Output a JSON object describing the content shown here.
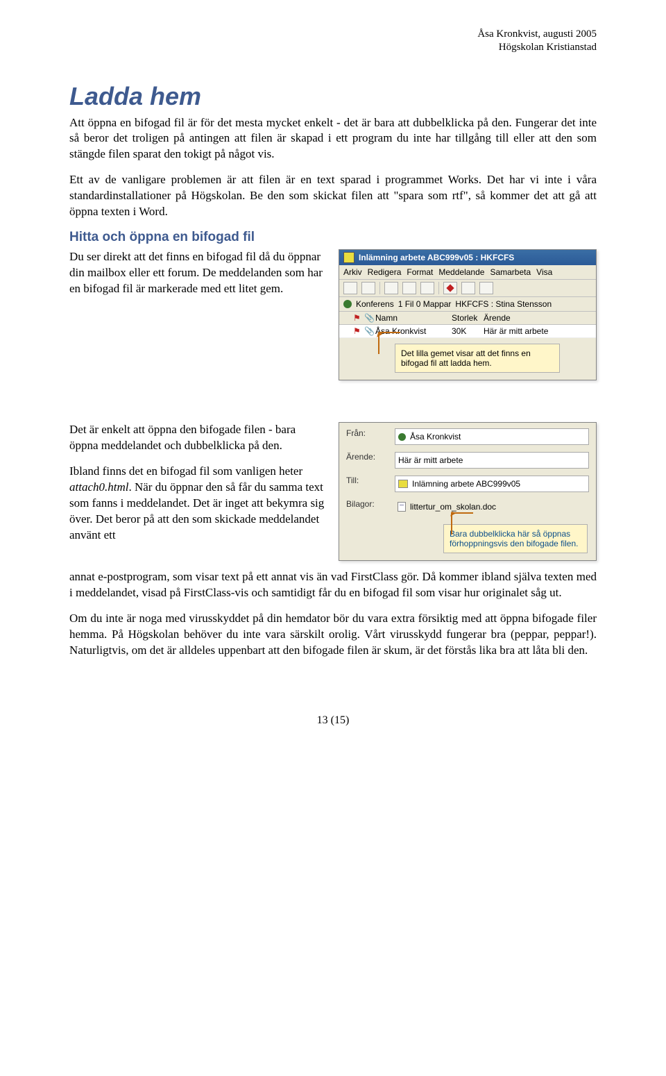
{
  "header": {
    "author_line": "Åsa Kronkvist, augusti 2005",
    "org_line": "Högskolan Kristianstad"
  },
  "title": "Ladda hem",
  "p1": "Att öppna en bifogad fil är för det mesta mycket enkelt - det är bara att dubbelklicka på den. Fungerar det inte så beror det troligen på antingen att filen är skapad i ett program du inte har tillgång till eller att den som stängde filen sparat den tokigt på något vis.",
  "p2": "Ett av de vanligare problemen är att filen är en text sparad i programmet Works. Det har vi inte i våra standardinstallationer på Högskolan. Be den som skickat filen att \"spara som rtf\", så kommer det att gå att öppna texten i Word.",
  "subtitle1": "Hitta och öppna en bifogad fil",
  "p3": "Du ser direkt att det finns en bifogad fil då du öppnar din mailbox eller ett forum. De meddelanden som har en bifogad fil är markerade med ett litet gem.",
  "p4": "Det är enkelt att öppna den bifogade filen - bara öppna meddelandet och dubbelklicka på den.",
  "p5a": "Ibland finns det en bifogad fil som vanligen heter ",
  "p5_italic": "attach0.html",
  "p5b": ". När du öppnar den så får du samma text som fanns i meddelandet. Det är inget att bekymra sig över. Det beror på att den som skickade meddelandet använt ett annat e-postprogram, som visar text på ett annat vis än vad FirstClass gör. Då kommer ibland själva texten med i meddelandet, visad på FirstClass-vis och samtidigt får du en bifogad fil som visar hur originalet såg ut.",
  "p6": "Om du inte är noga med virusskyddet på din hemdator bör du vara extra försiktig med att öppna bifogade filer hemma. På Högskolan behöver du inte vara särskilt orolig. Vårt virusskydd fungerar bra (peppar, peppar!). Naturligtvis, om det är alldeles uppenbart att den bifogade filen är skum, är det förstås lika bra att låta bli den.",
  "footer": "13 (15)",
  "fc": {
    "window_title": "Inlämning arbete ABC999v05 : HKFCFS",
    "menu": [
      "Arkiv",
      "Redigera",
      "Format",
      "Meddelande",
      "Samarbeta",
      "Visa"
    ],
    "info_conf": "Konferens",
    "info_files": "1 Fil 0 Mappar",
    "info_user": "HKFCFS : Stina Stensson",
    "head_name": "Namn",
    "head_size": "Storlek",
    "head_subject": "Ärende",
    "row_name": "Åsa Kronkvist",
    "row_size": "30K",
    "row_subject": "Här är mitt arbete",
    "callout": "Det lilla gemet visar att det finns en bifogad fil att ladda hem."
  },
  "msg": {
    "label_from": "Från:",
    "val_from": "Åsa Kronkvist",
    "label_subject": "Ärende:",
    "val_subject": "Här är mitt arbete",
    "label_to": "Till:",
    "val_to": "Inlämning arbete ABC999v05",
    "label_attach": "Bilagor:",
    "val_attach": "littertur_om_skolan.doc",
    "callout": "Bara dubbelklicka här så öppnas förhoppningsvis den bifogade filen."
  }
}
